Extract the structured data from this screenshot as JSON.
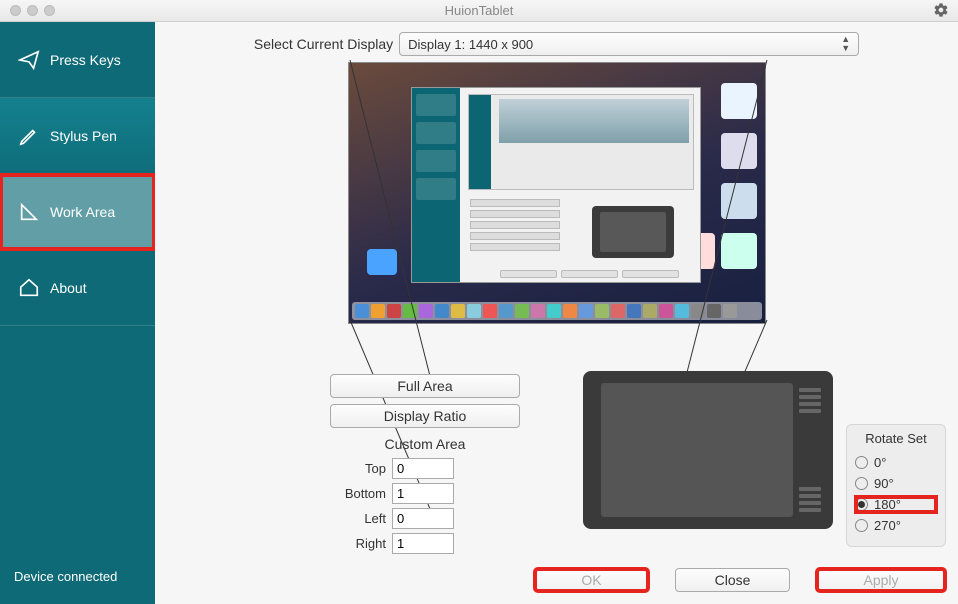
{
  "window": {
    "title": "HuionTablet"
  },
  "sidebar": {
    "items": [
      {
        "label": "Press Keys"
      },
      {
        "label": "Stylus Pen"
      },
      {
        "label": "Work Area"
      },
      {
        "label": "About"
      }
    ],
    "status": "Device connected"
  },
  "display": {
    "label": "Select Current Display",
    "selected": "Display 1: 1440 x  900"
  },
  "area": {
    "full": "Full Area",
    "ratio": "Display Ratio",
    "custom_header": "Custom Area",
    "top_label": "Top",
    "top": "0",
    "bottom_label": "Bottom",
    "bottom": "1",
    "left_label": "Left",
    "left": "0",
    "right_label": "Right",
    "right": "1"
  },
  "rotate": {
    "header": "Rotate Set",
    "options": [
      "0°",
      "90°",
      "180°",
      "270°"
    ],
    "selected_index": 2
  },
  "buttons": {
    "ok": "OK",
    "close": "Close",
    "apply": "Apply"
  }
}
